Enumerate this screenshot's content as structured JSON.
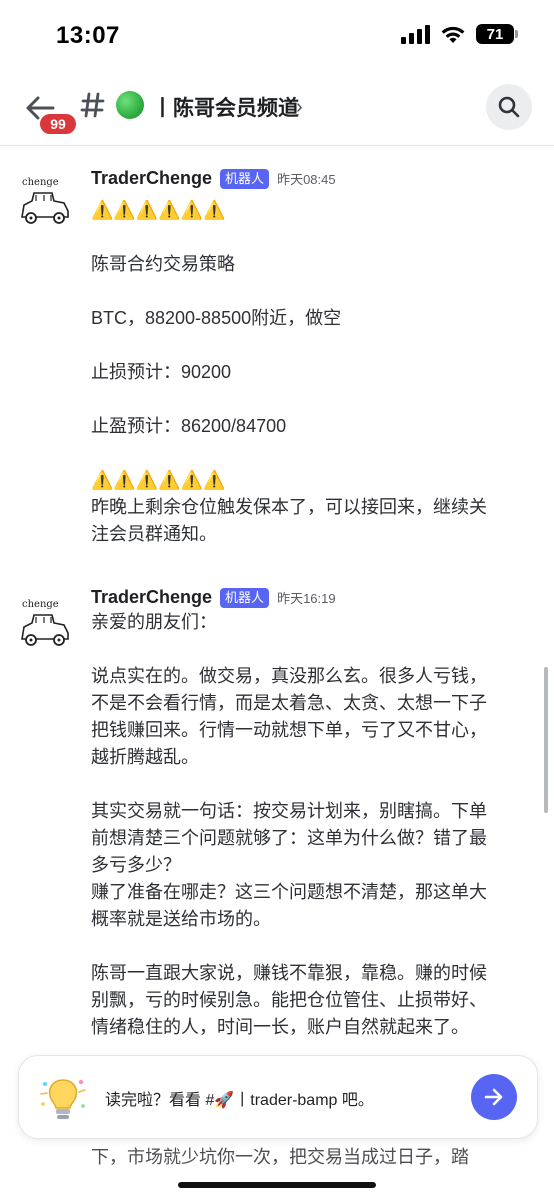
{
  "status_bar": {
    "time": "13:07",
    "battery": "71"
  },
  "header": {
    "unread_count": "99",
    "channel_name": "丨陈哥会员频道",
    "channel_emoji": "green-circle",
    "chevron": "›"
  },
  "messages": [
    {
      "author": "TraderChenge",
      "bot_tag": "机器人",
      "timestamp": "昨天08:45",
      "avatar_label": "chenge",
      "lines": [
        "⚠️⚠️⚠️⚠️⚠️⚠️",
        "",
        "陈哥合约交易策略",
        "",
        "BTC，88200-88500附近，做空",
        "",
        "止损预计：90200",
        "",
        "止盈预计：86200/84700",
        "",
        "⚠️⚠️⚠️⚠️⚠️⚠️",
        "昨晚上剩余仓位触发保本了，可以接回来，继续关",
        "注会员群通知。"
      ]
    },
    {
      "author": "TraderChenge",
      "bot_tag": "机器人",
      "timestamp": "昨天16:19",
      "avatar_label": "chenge",
      "lines": [
        "亲爱的朋友们：",
        "",
        "说点实在的。做交易，真没那么玄。很多人亏钱，",
        "不是不会看行情，而是太着急、太贪、太想一下子",
        "把钱赚回来。行情一动就想下单，亏了又不甘心，",
        "越折腾越乱。",
        "",
        "其实交易就一句话：按交易计划来，别瞎搞。下单",
        "前想清楚三个问题就够了：这单为什么做？错了最",
        "多亏多少？",
        "赚了准备在哪走？这三个问题想不清楚，那这单大",
        "概率就是送给市场的。",
        "",
        "陈哥一直跟大家说，赚钱不靠狠，靠稳。赚的时候",
        "别飘，亏的时候别急。能把仓位管住、止损带好、",
        "情绪稳住的人，时间一长，账户自然就起来了。"
      ]
    }
  ],
  "read_card": {
    "text": "读完啦？看看 #🚀丨trader-bamp 吧。"
  },
  "peek_text": "下，市场就少坑你一次，把交易当成过日子，踏"
}
